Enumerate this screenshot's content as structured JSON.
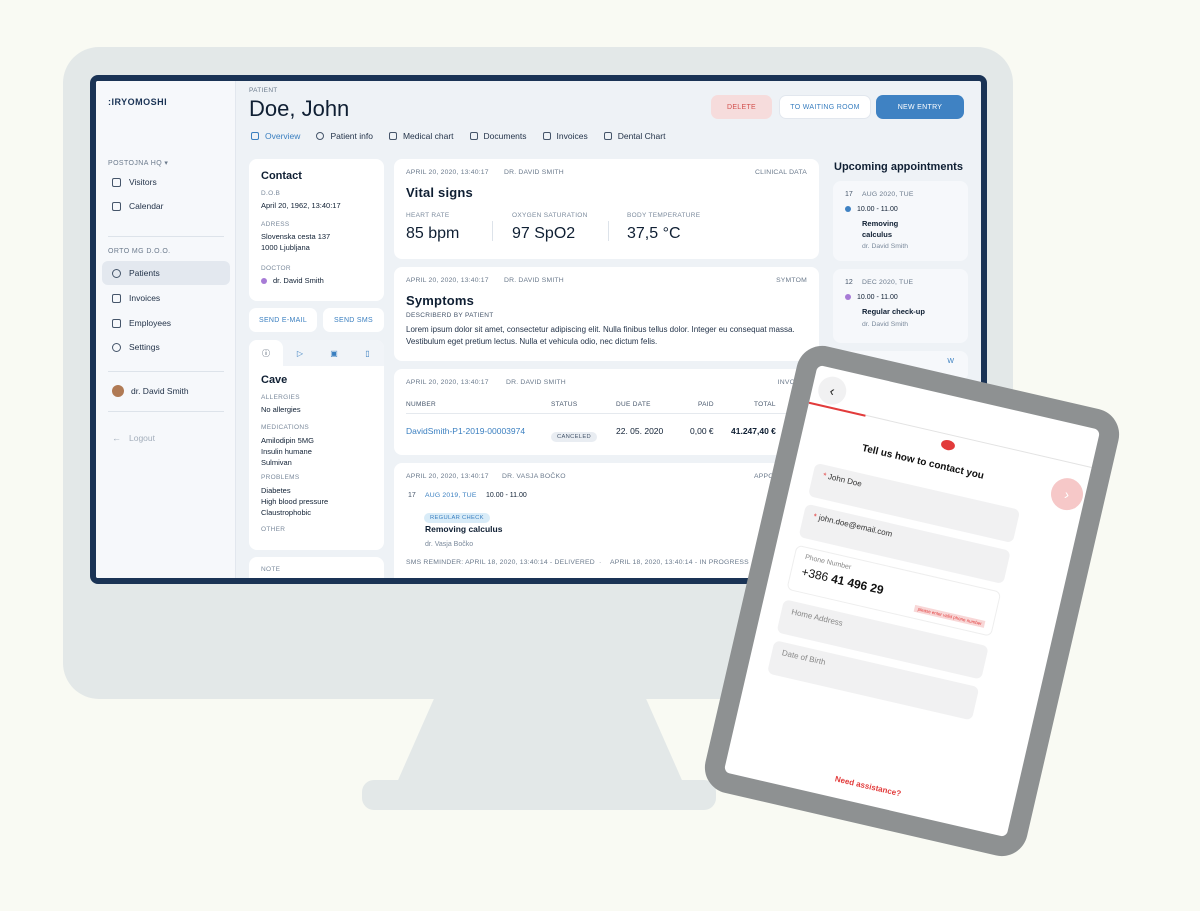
{
  "logo": ":IRYOMOSHI",
  "sidebar": {
    "location": "POSTOJNA HQ ▾",
    "items_top": [
      {
        "label": "Visitors"
      },
      {
        "label": "Calendar"
      }
    ],
    "section2": "ORTO MG D.O.O.",
    "items_main": [
      {
        "label": "Patients"
      },
      {
        "label": "Invoices"
      },
      {
        "label": "Employees"
      },
      {
        "label": "Settings"
      }
    ],
    "user": "dr. David Smith",
    "logout": "Logout"
  },
  "header": {
    "label": "PATIENT",
    "name": "Doe, John",
    "delete": "DELETE",
    "waiting": "TO WAITING ROOM",
    "new_entry": "NEW ENTRY"
  },
  "tabs": [
    "Overview",
    "Patient info",
    "Medical chart",
    "Documents",
    "Invoices",
    "Dental Chart"
  ],
  "contact": {
    "title": "Contact",
    "dob_label": "D.O.B",
    "dob": "April 20, 1962, 13:40:17",
    "address_label": "ADRESS",
    "address1": "Slovenska cesta 137",
    "address2": "1000 Ljubljana",
    "doctor_label": "DOCTOR",
    "doctor": "dr. David Smith",
    "send_email": "SEND E-MAIL",
    "send_sms": "SEND SMS"
  },
  "cave": {
    "title": "Cave",
    "allergies_label": "ALLERGIES",
    "allergies": "No allergies",
    "medications_label": "MEDICATIONS",
    "medications": [
      "Amilodipin 5MG",
      "Insulin humane",
      "Sulmivan"
    ],
    "problems_label": "PROBLEMS",
    "problems": [
      "Diabetes",
      "High blood pressure",
      "Claustrophobic"
    ],
    "other_label": "OTHER",
    "note_label": "NOTE"
  },
  "vitals": {
    "date": "APRIL 20, 2020, 13:40:17",
    "doctor": "DR. DAVID SMITH",
    "tag": "CLINICAL DATA",
    "title": "Vital signs",
    "items": [
      {
        "label": "HEART RATE",
        "value": "85 bpm"
      },
      {
        "label": "OXYGEN SATURATION",
        "value": "97 SpO2"
      },
      {
        "label": "BODY TEMPERATURE",
        "value": "37,5 °C"
      }
    ]
  },
  "symptoms": {
    "date": "APRIL 20, 2020, 13:40:17",
    "doctor": "DR. DAVID SMITH",
    "tag": "SYMTOM",
    "title": "Symptoms",
    "sub": "DESCRIBERD BY PATIENT",
    "text": "Lorem ipsum dolor sit amet, consectetur adipiscing elit. Nulla finibus tellus dolor. Integer eu consequat massa. Vestibulum eget pretium lectus. Nulla et vehicula odio, nec dictum felis."
  },
  "invoice": {
    "date": "APRIL 20, 2020, 13:40:17",
    "doctor": "DR. DAVID SMITH",
    "tag": "INVOICE",
    "headers": [
      "NUMBER",
      "STATUS",
      "DUE DATE",
      "PAID",
      "TOTAL"
    ],
    "row": {
      "number": "DavidSmith-P1-2019-00003974",
      "status": "CANCELED",
      "due": "22. 05. 2020",
      "paid": "0,00 €",
      "total": "41.247,40 €"
    }
  },
  "appointment_card": {
    "date": "APRIL 20, 2020, 13:40:17",
    "doctor": "DR. VASJA BOČKO",
    "tag": "APPOINTME",
    "day": "17",
    "date2": "AUG 2019, TUE",
    "time": "10.00 - 11.00",
    "badge": "REGULAR CHECK",
    "title": "Removing calculus",
    "doc": "dr. Vasja Bočko",
    "sms": "SMS REMINDER: APRIL 18, 2020, 13:40:14 - DELIVERED",
    "status": "APRIL 18, 2020, 13:40:14 - IN PROGRESS"
  },
  "upcoming": {
    "title": "Upcoming appointments",
    "items": [
      {
        "day": "17",
        "date": "AUG 2020, TUE",
        "time": "10.00 - 11.00",
        "title1": "Removing",
        "title2": "calculus",
        "doctor": "dr. David Smith"
      },
      {
        "day": "12",
        "date": "DEC 2020, TUE",
        "time": "10.00 - 11.00",
        "title1": "Regular check-up",
        "title2": "",
        "doctor": "dr. David Smith"
      }
    ],
    "partial": "W"
  },
  "tablet": {
    "heading": "Tell us how to contact you",
    "name": "John Doe",
    "email": "john.doe@email.com",
    "phone_label": "Phone Number",
    "phone_prefix": "+386",
    "phone": "41 496 29",
    "error": "please enter valid phone number",
    "address": "Home Address",
    "dob": "Date of Birth",
    "help": "Need assistance?"
  }
}
